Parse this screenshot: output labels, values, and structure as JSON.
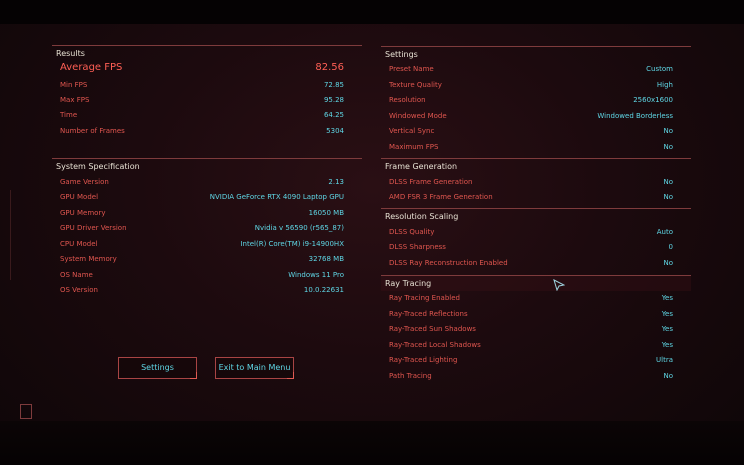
{
  "results": {
    "header": "Results",
    "rows": [
      {
        "label": "Average FPS",
        "value": "82.56"
      },
      {
        "label": "Min FPS",
        "value": "72.85"
      },
      {
        "label": "Max FPS",
        "value": "95.28"
      },
      {
        "label": "Time",
        "value": "64.25"
      },
      {
        "label": "Number of Frames",
        "value": "5304"
      }
    ]
  },
  "system": {
    "header": "System Specification",
    "rows": [
      {
        "label": "Game Version",
        "value": "2.13"
      },
      {
        "label": "GPU Model",
        "value": "NVIDIA GeForce RTX 4090 Laptop GPU"
      },
      {
        "label": "GPU Memory",
        "value": "16050 MB"
      },
      {
        "label": "GPU Driver Version",
        "value": "Nvidia v 56590 (r565_87)"
      },
      {
        "label": "CPU Model",
        "value": "Intel(R) Core(TM) i9-14900HX"
      },
      {
        "label": "System Memory",
        "value": "32768 MB"
      },
      {
        "label": "OS Name",
        "value": "Windows 11 Pro"
      },
      {
        "label": "OS Version",
        "value": "10.0.22631"
      }
    ]
  },
  "settings": {
    "header": "Settings",
    "rows": [
      {
        "label": "Preset Name",
        "value": "Custom"
      },
      {
        "label": "Texture Quality",
        "value": "High"
      },
      {
        "label": "Resolution",
        "value": "2560x1600"
      },
      {
        "label": "Windowed Mode",
        "value": "Windowed Borderless"
      },
      {
        "label": "Vertical Sync",
        "value": "No"
      },
      {
        "label": "Maximum FPS",
        "value": "No"
      }
    ]
  },
  "framegen": {
    "header": "Frame Generation",
    "rows": [
      {
        "label": "DLSS Frame Generation",
        "value": "No"
      },
      {
        "label": "AMD FSR 3 Frame Generation",
        "value": "No"
      }
    ]
  },
  "scaling": {
    "header": "Resolution Scaling",
    "rows": [
      {
        "label": "DLSS Quality",
        "value": "Auto"
      },
      {
        "label": "DLSS Sharpness",
        "value": "0"
      },
      {
        "label": "DLSS Ray Reconstruction Enabled",
        "value": "No"
      }
    ]
  },
  "raytracing": {
    "header": "Ray Tracing",
    "rows": [
      {
        "label": "Ray Tracing Enabled",
        "value": "Yes"
      },
      {
        "label": "Ray-Traced Reflections",
        "value": "Yes"
      },
      {
        "label": "Ray-Traced Sun Shadows",
        "value": "Yes"
      },
      {
        "label": "Ray-Traced Local Shadows",
        "value": "Yes"
      },
      {
        "label": "Ray-Traced Lighting",
        "value": "Ultra"
      },
      {
        "label": "Path Tracing",
        "value": "No"
      }
    ]
  },
  "buttons": {
    "settings": "Settings",
    "exit": "Exit to Main Menu"
  },
  "colors": {
    "label": "#e0564f",
    "value": "#5fd7e6",
    "header": "#e8e2d4",
    "accent": "#ff5f55"
  }
}
